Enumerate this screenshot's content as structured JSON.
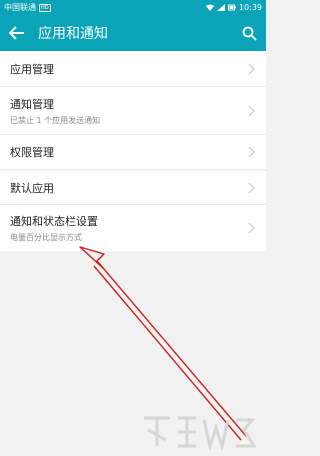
{
  "status_bar": {
    "carrier": "中国联通",
    "hd": "HD",
    "time": "10:39"
  },
  "header": {
    "title": "应用和通知",
    "back_icon": "arrow-left-icon",
    "search_icon": "search-icon"
  },
  "settings": {
    "group1": [
      {
        "title": "应用管理",
        "subtitle": ""
      },
      {
        "title": "通知管理",
        "subtitle": "已禁止 1 个应用发送通知"
      },
      {
        "title": "权限管理",
        "subtitle": ""
      }
    ],
    "group2": [
      {
        "title": "默认应用",
        "subtitle": ""
      },
      {
        "title": "通知和状态栏设置",
        "subtitle": "电量百分比显示方式"
      }
    ]
  },
  "annotation": {
    "arrow_color": "#cc1f1f"
  },
  "colors": {
    "accent": "#0aa3b8"
  }
}
